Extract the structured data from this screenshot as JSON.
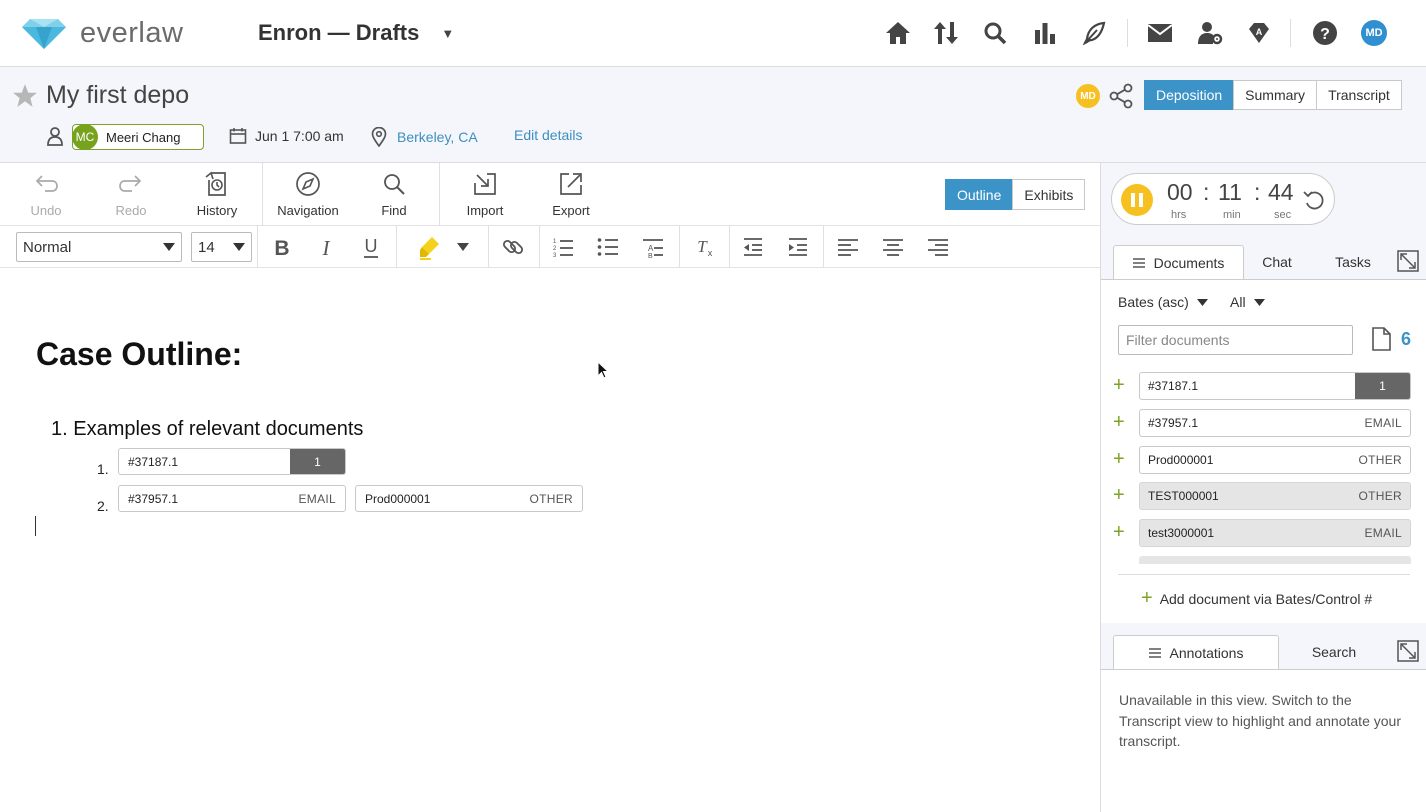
{
  "nav": {
    "logo_text": "everlaw",
    "project": "Enron — Drafts",
    "avatar": "MD",
    "icons": [
      "home-icon",
      "upload-download-icon",
      "search-icon",
      "analytics-icon",
      "feather-icon",
      "mail-icon",
      "user-settings-icon",
      "assistant-icon",
      "help-icon"
    ],
    "brand_color": "#3b93c8"
  },
  "header": {
    "title": "My first depo",
    "user_initials": "MC",
    "user_name": "Meeri Chang",
    "date": "Jun 1 7:00 am",
    "location": "Berkeley, CA",
    "edit": "Edit details",
    "collab_avatar": "MD",
    "tabs": [
      {
        "label": "Deposition",
        "active": true
      },
      {
        "label": "Summary",
        "active": false
      },
      {
        "label": "Transcript",
        "active": false
      }
    ]
  },
  "toolbar": {
    "buttons": [
      "Undo",
      "Redo",
      "History",
      "Navigation",
      "Find",
      "Import",
      "Export"
    ],
    "view_tabs": [
      {
        "label": "Outline",
        "active": true
      },
      {
        "label": "Exhibits",
        "active": false
      }
    ],
    "style_select": "Normal",
    "size_select": "14"
  },
  "editor": {
    "heading": "Case Outline:",
    "item1_num": "1.",
    "item1_text": "Examples of relevant documents",
    "sub1_num": "1.",
    "sub2_num": "2.",
    "chips": [
      {
        "code": "#37187.1",
        "type": "1"
      },
      {
        "code": "#37957.1",
        "type": "EMAIL"
      },
      {
        "code": "Prod000001",
        "type": "OTHER"
      }
    ]
  },
  "timer": {
    "hrs": "00",
    "min": "11",
    "sec": "44",
    "sep": ":",
    "hrs_label": "hrs",
    "min_label": "min",
    "sec_label": "sec"
  },
  "doc_tabs": [
    {
      "label": "Documents",
      "active": true
    },
    {
      "label": "Chat",
      "active": false
    },
    {
      "label": "Tasks",
      "active": false
    }
  ],
  "documents": {
    "sort": "Bates (asc)",
    "filter_all": "All",
    "filter_placeholder": "Filter documents",
    "count": "6",
    "rows": [
      {
        "code": "#37187.1",
        "type": "1",
        "gray": false
      },
      {
        "code": "#37957.1",
        "type": "EMAIL",
        "gray": false
      },
      {
        "code": "Prod000001",
        "type": "OTHER",
        "gray": false
      },
      {
        "code": "TEST000001",
        "type": "OTHER",
        "gray": true
      },
      {
        "code": "test3000001",
        "type": "EMAIL",
        "gray": true
      }
    ],
    "add": "Add document via Bates/Control #"
  },
  "annotation_tabs": [
    {
      "label": "Annotations",
      "active": true
    },
    {
      "label": "Search",
      "active": false
    }
  ],
  "annotations": {
    "message": "Unavailable in this view. Switch to the Transcript view to highlight and annotate your transcript."
  }
}
